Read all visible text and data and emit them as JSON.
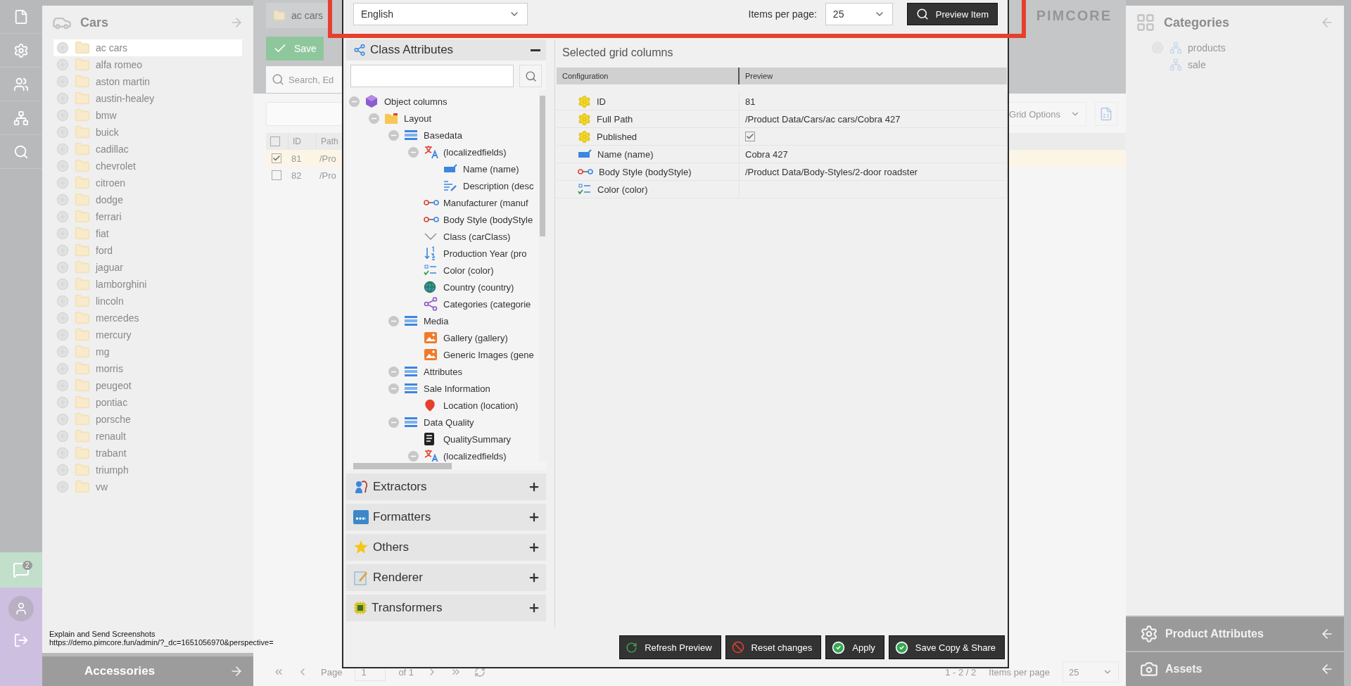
{
  "nav": {
    "chat_badge": "2"
  },
  "left_tree": {
    "title": "Cars",
    "items": [
      {
        "label": "ac cars",
        "selected": true
      },
      {
        "label": "alfa romeo",
        "selected": false
      },
      {
        "label": "aston martin",
        "selected": false
      },
      {
        "label": "austin-healey",
        "selected": false
      },
      {
        "label": "bmw",
        "selected": false
      },
      {
        "label": "buick",
        "selected": false
      },
      {
        "label": "cadillac",
        "selected": false
      },
      {
        "label": "chevrolet",
        "selected": false
      },
      {
        "label": "citroen",
        "selected": false
      },
      {
        "label": "dodge",
        "selected": false
      },
      {
        "label": "ferrari",
        "selected": false
      },
      {
        "label": "fiat",
        "selected": false
      },
      {
        "label": "ford",
        "selected": false
      },
      {
        "label": "jaguar",
        "selected": false
      },
      {
        "label": "lamborghini",
        "selected": false
      },
      {
        "label": "lincoln",
        "selected": false
      },
      {
        "label": "mercedes",
        "selected": false
      },
      {
        "label": "mercury",
        "selected": false
      },
      {
        "label": "mg",
        "selected": false
      },
      {
        "label": "morris",
        "selected": false
      },
      {
        "label": "peugeot",
        "selected": false
      },
      {
        "label": "pontiac",
        "selected": false
      },
      {
        "label": "porsche",
        "selected": false
      },
      {
        "label": "renault",
        "selected": false
      },
      {
        "label": "trabant",
        "selected": false
      },
      {
        "label": "triumph",
        "selected": false
      },
      {
        "label": "vw",
        "selected": false
      }
    ]
  },
  "accessories": "Accessories",
  "status": {
    "title": "Explain and Send Screenshots",
    "url": "https://demo.pimcore.fun/admin/?_dc=1651056970&perspective="
  },
  "editor": {
    "tab": "ac cars",
    "save_button": "Save",
    "search": {
      "placeholder": "Search, Ed"
    },
    "grid_options": "Grid Options",
    "grid": {
      "all_checked": false,
      "columns": [
        "ID",
        "Path"
      ],
      "rows": [
        {
          "id": "81",
          "path": "/Pro",
          "checked": true
        },
        {
          "id": "82",
          "path": "/Pro",
          "checked": false
        }
      ]
    },
    "pager": {
      "page_label": "Page",
      "page": "1",
      "of": "of 1",
      "range": "1 - 2 / 2",
      "per_page_label": "Items per page",
      "per_page": "25"
    }
  },
  "logo": "PIMCORE",
  "right_panel": {
    "title": "Categories",
    "items": [
      {
        "label": "products",
        "has_children": true
      },
      {
        "label": "sale",
        "has_children": false
      }
    ]
  },
  "bottom_panels": [
    {
      "label": "Product Attributes",
      "kind": "gear"
    },
    {
      "label": "Assets",
      "kind": "camera"
    }
  ],
  "dialog": {
    "language": "English",
    "per_page_label": "Items per page:",
    "per_page": "25",
    "preview_button": "Preview Item",
    "class_attributes": {
      "title": "Class Attributes",
      "expanded": true,
      "tree": [
        {
          "label": "Object columns",
          "kind": "object",
          "expanded": true,
          "children": [
            {
              "label": "Layout",
              "kind": "folder",
              "expanded": true,
              "children": [
                {
                  "label": "Basedata",
                  "kind": "panel",
                  "expanded": true,
                  "children": [
                    {
                      "label": "(localizedfields)",
                      "kind": "localized",
                      "expanded": true,
                      "children": [
                        {
                          "label": "Name (name)",
                          "kind": "input"
                        },
                        {
                          "label": "Description (desc",
                          "kind": "textarea"
                        }
                      ]
                    },
                    {
                      "label": "Manufacturer (manuf",
                      "kind": "relation"
                    },
                    {
                      "label": "Body Style (bodyStyle",
                      "kind": "relation"
                    },
                    {
                      "label": "Class (carClass)",
                      "kind": "select"
                    },
                    {
                      "label": "Production Year (pro",
                      "kind": "numeric"
                    },
                    {
                      "label": "Color (color)",
                      "kind": "multiselect"
                    },
                    {
                      "label": "Country (country)",
                      "kind": "country"
                    },
                    {
                      "label": "Categories (categorie",
                      "kind": "categories"
                    }
                  ]
                },
                {
                  "label": "Media",
                  "kind": "panel",
                  "expanded": true,
                  "children": [
                    {
                      "label": "Gallery (gallery)",
                      "kind": "image"
                    },
                    {
                      "label": "Generic Images (gene",
                      "kind": "image"
                    }
                  ]
                },
                {
                  "label": "Attributes",
                  "kind": "panel",
                  "expanded": true
                },
                {
                  "label": "Sale Information",
                  "kind": "panel",
                  "expanded": true,
                  "children": [
                    {
                      "label": "Location (location)",
                      "kind": "location"
                    }
                  ]
                },
                {
                  "label": "Data Quality",
                  "kind": "panel",
                  "expanded": true,
                  "children": [
                    {
                      "label": "QualitySummary",
                      "kind": "summary"
                    },
                    {
                      "label": "(localizedfields)",
                      "kind": "localized",
                      "expanded": true
                    }
                  ]
                }
              ]
            }
          ]
        }
      ]
    },
    "sections": [
      {
        "label": "Extractors",
        "kind": "extractors",
        "expanded": false
      },
      {
        "label": "Formatters",
        "kind": "formatters",
        "expanded": false
      },
      {
        "label": "Others",
        "kind": "others",
        "expanded": false
      },
      {
        "label": "Renderer",
        "kind": "renderer",
        "expanded": false
      },
      {
        "label": "Transformers",
        "kind": "transformers",
        "expanded": false
      }
    ],
    "selected": {
      "title": "Selected grid columns",
      "columns": [
        "Configuration",
        "Preview"
      ],
      "rows": [
        {
          "config": "ID",
          "kind": "system",
          "preview": "81"
        },
        {
          "config": "Full Path",
          "kind": "system",
          "preview": "/Product Data/Cars/ac cars/Cobra 427"
        },
        {
          "config": "Published",
          "kind": "system",
          "checked": true
        },
        {
          "config": "Name (name)",
          "kind": "input",
          "preview": "Cobra 427"
        },
        {
          "config": "Body Style (bodyStyle)",
          "kind": "relation",
          "preview": "/Product Data/Body-Styles/2-door roadster"
        },
        {
          "config": "Color (color)",
          "kind": "multiselect"
        }
      ]
    },
    "buttons": [
      {
        "label": "Refresh Preview",
        "kind": "refresh"
      },
      {
        "label": "Reset changes",
        "kind": "reset"
      },
      {
        "label": "Apply",
        "kind": "apply"
      },
      {
        "label": "Save Copy & Share",
        "kind": "apply"
      }
    ]
  }
}
